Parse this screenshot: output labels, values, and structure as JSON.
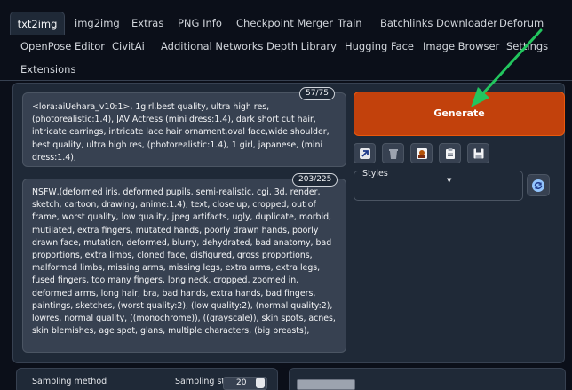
{
  "tabs": [
    {
      "label": "txt2img",
      "active": true
    },
    {
      "label": "img2img"
    },
    {
      "label": "Extras"
    },
    {
      "label": "PNG Info"
    },
    {
      "label": "Checkpoint Merger"
    },
    {
      "label": "Train"
    },
    {
      "label": "Batchlinks Downloader"
    },
    {
      "label": "Deforum"
    },
    {
      "label": "OpenPose Editor"
    },
    {
      "label": "CivitAi"
    },
    {
      "label": "Additional Networks"
    },
    {
      "label": "Depth Library"
    },
    {
      "label": "Hugging Face"
    },
    {
      "label": "Image Browser"
    },
    {
      "label": "Settings"
    },
    {
      "label": "Extensions"
    }
  ],
  "prompt": {
    "token_count": "57/75",
    "text": "<lora:aiUehara_v10:1>, 1girl,best quality, ultra high res, (photorealistic:1.4), JAV Actress (mini dress:1.4), dark short cut hair, intricate earrings, intricate lace hair ornament,oval face,wide shoulder, best quality, ultra high res, (photorealistic:1.4), 1 girl, japanese, (mini dress:1.4),"
  },
  "negative_prompt": {
    "token_count": "203/225",
    "text": "NSFW,(deformed iris, deformed pupils, semi-realistic, cgi, 3d, render, sketch, cartoon, drawing, anime:1.4), text, close up, cropped, out of frame, worst quality, low quality, jpeg artifacts, ugly, duplicate, morbid, mutilated, extra fingers, mutated hands, poorly drawn hands, poorly drawn face, mutation, deformed, blurry, dehydrated, bad anatomy, bad proportions, extra limbs, cloned face, disfigured, gross proportions, malformed limbs, missing arms, missing legs, extra arms, extra legs, fused fingers, too many fingers, long neck, cropped, zoomed in, deformed arms, long hair, bra, bad hands, extra hands, bad fingers, paintings, sketches, (worst quality:2), (low quality:2), (normal quality:2), lowres, normal quality, ((monochrome)), ((grayscale)), skin spots, acnes, skin blemishes, age spot, glans, multiple characters, (big breasts),"
  },
  "generate": {
    "label": "Generate"
  },
  "tools": [
    "read-params-icon",
    "trash-icon",
    "extra-networks-icon",
    "clipboard-icon",
    "save-icon"
  ],
  "styles": {
    "label": "Styles",
    "value": ""
  },
  "sampling": {
    "method_label": "Sampling method",
    "steps_label": "Sampling ste",
    "steps_value": "20"
  },
  "colors": {
    "background": "#0b0f19",
    "panel": "#1f2937",
    "input": "#374151",
    "generate": "#c2410c",
    "arrow": "#22c55e"
  }
}
